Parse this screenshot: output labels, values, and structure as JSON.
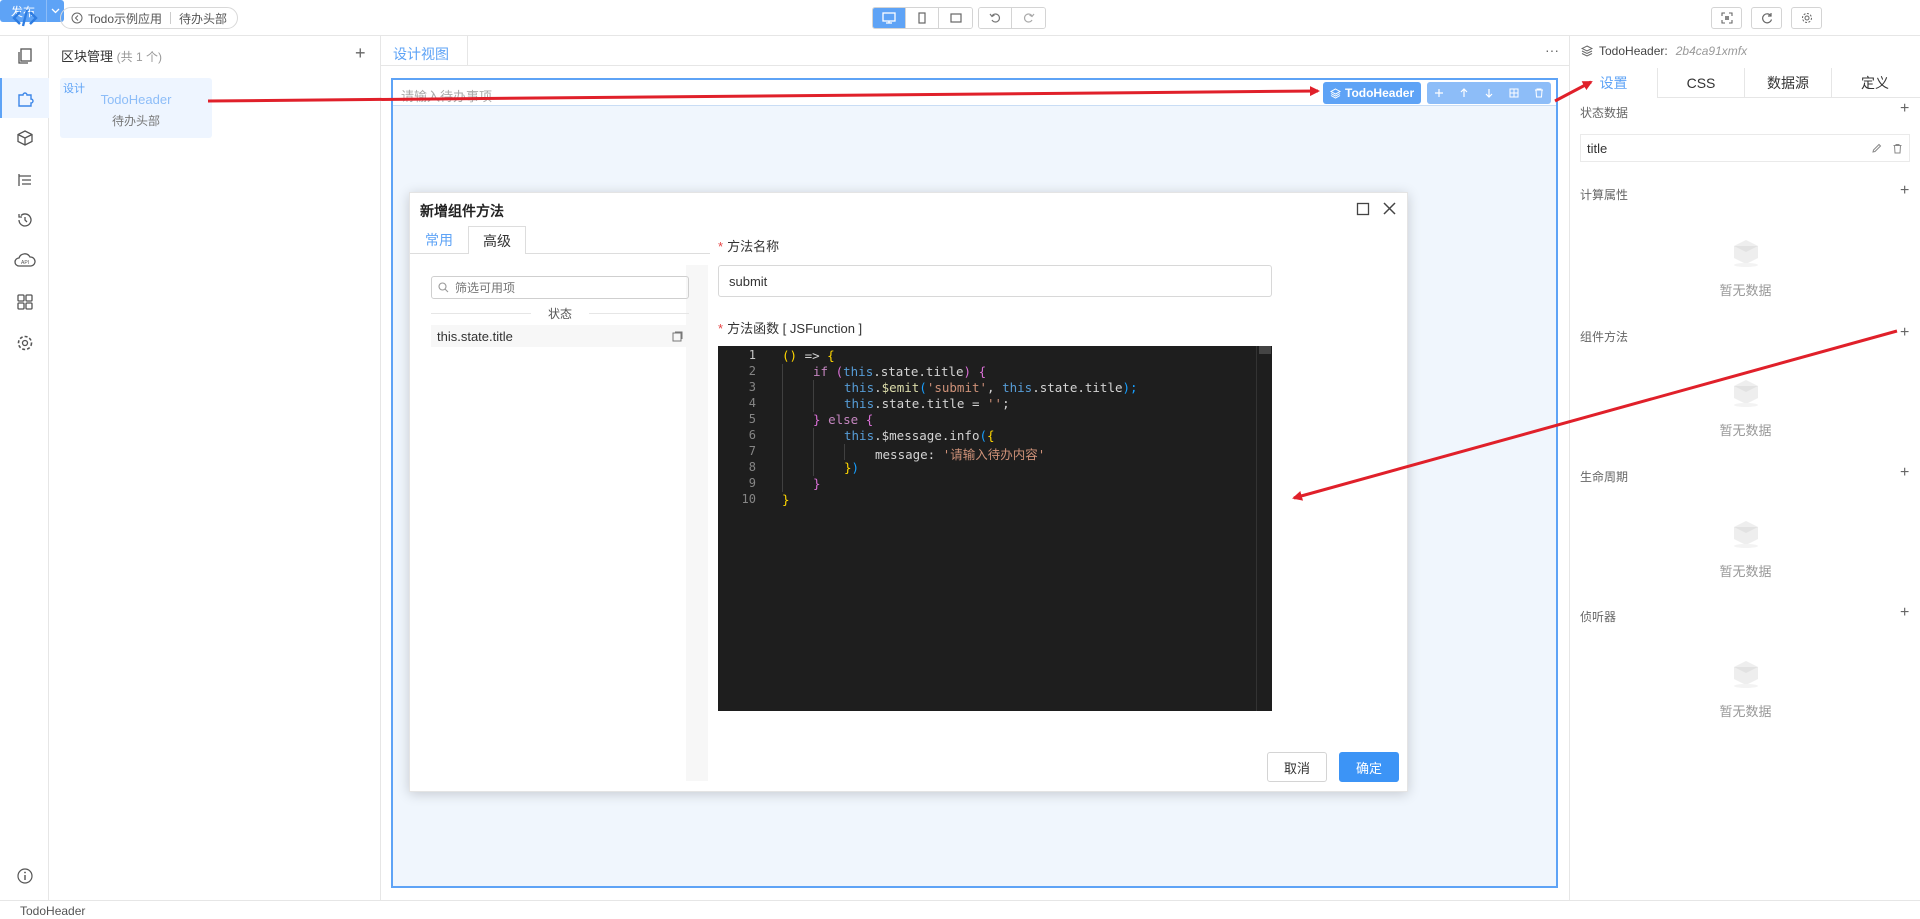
{
  "topbar": {
    "breadcrumb_app": "Todo示例应用",
    "breadcrumb_block": "待办头部",
    "publish_label": "发布"
  },
  "blocks": {
    "title": "区块管理",
    "count": "(共 1 个)",
    "card": {
      "tag": "设计",
      "name": "TodoHeader",
      "subtitle": "待办头部"
    }
  },
  "canvas": {
    "tab_label": "设计视图",
    "more_icon": "more-horizontal-icon",
    "input_placeholder": "请输入待办事项",
    "selected_label": "TodoHeader"
  },
  "dialog": {
    "title": "新增组件方法",
    "tabs": [
      {
        "label": "常用"
      },
      {
        "label": "高级"
      }
    ],
    "filter_placeholder": "筛选可用项",
    "group_label": "状态",
    "state_items": [
      {
        "label": "this.state.title"
      }
    ],
    "method_name_label": "方法名称",
    "method_name_value": "submit",
    "method_func_label": "方法函数 [ JSFunction ]",
    "code": {
      "line_numbers": [
        "1",
        "2",
        "3",
        "4",
        "5",
        "6",
        "7",
        "8",
        "9",
        "10"
      ],
      "l1": [
        "()",
        " => ",
        "{"
      ],
      "l2": [
        "if",
        " (",
        "this",
        ".state.title",
        ") ",
        "{"
      ],
      "l3": [
        "this",
        ".",
        "$emit",
        "(",
        "'submit'",
        ", ",
        "this",
        ".state.title",
        ");"
      ],
      "l4": [
        "this",
        ".state.title = ",
        "''",
        ";"
      ],
      "l5": [
        "}",
        " ",
        "else",
        " ",
        "{"
      ],
      "l6": [
        "this",
        ".$message.info",
        "(",
        "{"
      ],
      "l7": [
        "message: ",
        "'请输入待办内容'"
      ],
      "l8": [
        "}",
        ")"
      ],
      "l9": [
        "}"
      ],
      "l10": [
        "}"
      ]
    },
    "cancel_label": "取消",
    "ok_label": "确定"
  },
  "right": {
    "component_name": "TodoHeader:",
    "component_id": "2b4ca91xmfx",
    "tabs": [
      {
        "label": "设置"
      },
      {
        "label": "CSS"
      },
      {
        "label": "数据源"
      },
      {
        "label": "定义"
      }
    ],
    "sections": {
      "state": {
        "title": "状态数据",
        "items": [
          {
            "label": "title"
          }
        ]
      },
      "computed": {
        "title": "计算属性",
        "empty": "暂无数据"
      },
      "methods": {
        "title": "组件方法",
        "empty": "暂无数据"
      },
      "lifecycle": {
        "title": "生命周期",
        "empty": "暂无数据"
      },
      "watchers": {
        "title": "侦听器",
        "empty": "暂无数据"
      }
    }
  },
  "statusbar": {
    "text": "TodoHeader"
  },
  "colors": {
    "accent": "#5ea3f6",
    "annotation_red": "#e0202a",
    "editor_bg": "#1e1e1e"
  }
}
